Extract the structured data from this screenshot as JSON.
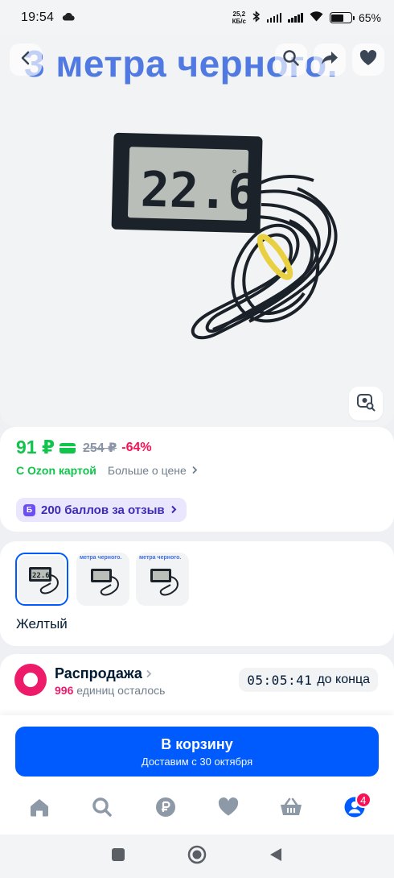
{
  "status_bar": {
    "time": "19:54",
    "speed_value": "25,2",
    "speed_unit": "КБ/с",
    "battery": "65%"
  },
  "product_image": {
    "banner_text": "3 метра черного.",
    "display_reading": "22.6"
  },
  "price": {
    "current": "91 ₽",
    "old": "254 ₽",
    "discount": "-64%",
    "ozon_card_label": "С Ozon картой",
    "more_about_price": "Больше о цене",
    "color_ozon": "#10c44c",
    "color_discount": "#f91155"
  },
  "review_points": {
    "label": "200 баллов за отзыв",
    "icon_letter": "Б"
  },
  "variants": {
    "thumb_banner": "метра черного.",
    "selected_color": "Желтый"
  },
  "sale": {
    "title": "Распродажа",
    "count": "996",
    "remaining_text": "единиц осталось",
    "timer": "05:05:41",
    "timer_suffix": "до конца"
  },
  "cart": {
    "label": "В корзину",
    "delivery": "Доставим с 30 октября",
    "accent": "#005bff"
  },
  "bottom_nav": {
    "items": [
      "home-icon",
      "search-icon",
      "ruble-icon",
      "heart-icon",
      "basket-icon",
      "profile-icon"
    ],
    "profile_badge": "4"
  }
}
